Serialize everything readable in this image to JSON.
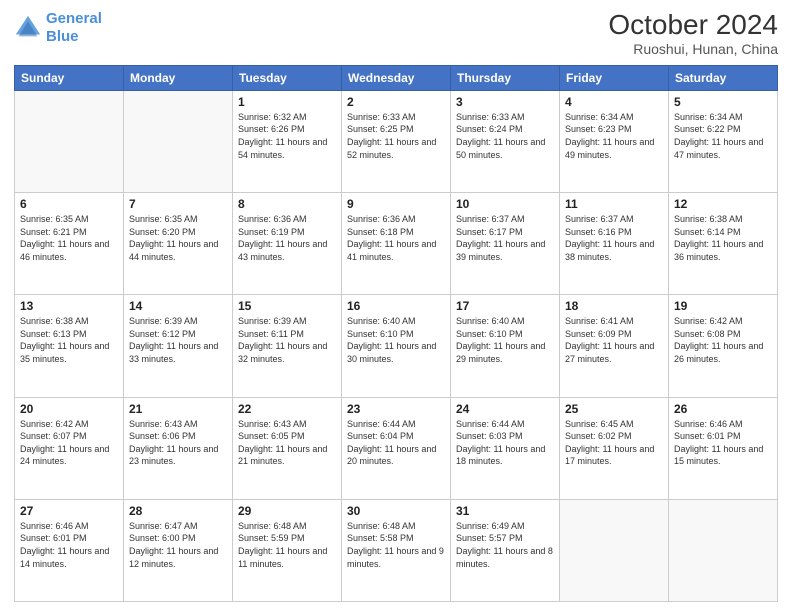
{
  "header": {
    "logo_line1": "General",
    "logo_line2": "Blue",
    "title": "October 2024",
    "subtitle": "Ruoshui, Hunan, China"
  },
  "weekdays": [
    "Sunday",
    "Monday",
    "Tuesday",
    "Wednesday",
    "Thursday",
    "Friday",
    "Saturday"
  ],
  "weeks": [
    [
      {
        "day": "",
        "info": ""
      },
      {
        "day": "",
        "info": ""
      },
      {
        "day": "1",
        "info": "Sunrise: 6:32 AM\nSunset: 6:26 PM\nDaylight: 11 hours and 54 minutes."
      },
      {
        "day": "2",
        "info": "Sunrise: 6:33 AM\nSunset: 6:25 PM\nDaylight: 11 hours and 52 minutes."
      },
      {
        "day": "3",
        "info": "Sunrise: 6:33 AM\nSunset: 6:24 PM\nDaylight: 11 hours and 50 minutes."
      },
      {
        "day": "4",
        "info": "Sunrise: 6:34 AM\nSunset: 6:23 PM\nDaylight: 11 hours and 49 minutes."
      },
      {
        "day": "5",
        "info": "Sunrise: 6:34 AM\nSunset: 6:22 PM\nDaylight: 11 hours and 47 minutes."
      }
    ],
    [
      {
        "day": "6",
        "info": "Sunrise: 6:35 AM\nSunset: 6:21 PM\nDaylight: 11 hours and 46 minutes."
      },
      {
        "day": "7",
        "info": "Sunrise: 6:35 AM\nSunset: 6:20 PM\nDaylight: 11 hours and 44 minutes."
      },
      {
        "day": "8",
        "info": "Sunrise: 6:36 AM\nSunset: 6:19 PM\nDaylight: 11 hours and 43 minutes."
      },
      {
        "day": "9",
        "info": "Sunrise: 6:36 AM\nSunset: 6:18 PM\nDaylight: 11 hours and 41 minutes."
      },
      {
        "day": "10",
        "info": "Sunrise: 6:37 AM\nSunset: 6:17 PM\nDaylight: 11 hours and 39 minutes."
      },
      {
        "day": "11",
        "info": "Sunrise: 6:37 AM\nSunset: 6:16 PM\nDaylight: 11 hours and 38 minutes."
      },
      {
        "day": "12",
        "info": "Sunrise: 6:38 AM\nSunset: 6:14 PM\nDaylight: 11 hours and 36 minutes."
      }
    ],
    [
      {
        "day": "13",
        "info": "Sunrise: 6:38 AM\nSunset: 6:13 PM\nDaylight: 11 hours and 35 minutes."
      },
      {
        "day": "14",
        "info": "Sunrise: 6:39 AM\nSunset: 6:12 PM\nDaylight: 11 hours and 33 minutes."
      },
      {
        "day": "15",
        "info": "Sunrise: 6:39 AM\nSunset: 6:11 PM\nDaylight: 11 hours and 32 minutes."
      },
      {
        "day": "16",
        "info": "Sunrise: 6:40 AM\nSunset: 6:10 PM\nDaylight: 11 hours and 30 minutes."
      },
      {
        "day": "17",
        "info": "Sunrise: 6:40 AM\nSunset: 6:10 PM\nDaylight: 11 hours and 29 minutes."
      },
      {
        "day": "18",
        "info": "Sunrise: 6:41 AM\nSunset: 6:09 PM\nDaylight: 11 hours and 27 minutes."
      },
      {
        "day": "19",
        "info": "Sunrise: 6:42 AM\nSunset: 6:08 PM\nDaylight: 11 hours and 26 minutes."
      }
    ],
    [
      {
        "day": "20",
        "info": "Sunrise: 6:42 AM\nSunset: 6:07 PM\nDaylight: 11 hours and 24 minutes."
      },
      {
        "day": "21",
        "info": "Sunrise: 6:43 AM\nSunset: 6:06 PM\nDaylight: 11 hours and 23 minutes."
      },
      {
        "day": "22",
        "info": "Sunrise: 6:43 AM\nSunset: 6:05 PM\nDaylight: 11 hours and 21 minutes."
      },
      {
        "day": "23",
        "info": "Sunrise: 6:44 AM\nSunset: 6:04 PM\nDaylight: 11 hours and 20 minutes."
      },
      {
        "day": "24",
        "info": "Sunrise: 6:44 AM\nSunset: 6:03 PM\nDaylight: 11 hours and 18 minutes."
      },
      {
        "day": "25",
        "info": "Sunrise: 6:45 AM\nSunset: 6:02 PM\nDaylight: 11 hours and 17 minutes."
      },
      {
        "day": "26",
        "info": "Sunrise: 6:46 AM\nSunset: 6:01 PM\nDaylight: 11 hours and 15 minutes."
      }
    ],
    [
      {
        "day": "27",
        "info": "Sunrise: 6:46 AM\nSunset: 6:01 PM\nDaylight: 11 hours and 14 minutes."
      },
      {
        "day": "28",
        "info": "Sunrise: 6:47 AM\nSunset: 6:00 PM\nDaylight: 11 hours and 12 minutes."
      },
      {
        "day": "29",
        "info": "Sunrise: 6:48 AM\nSunset: 5:59 PM\nDaylight: 11 hours and 11 minutes."
      },
      {
        "day": "30",
        "info": "Sunrise: 6:48 AM\nSunset: 5:58 PM\nDaylight: 11 hours and 9 minutes."
      },
      {
        "day": "31",
        "info": "Sunrise: 6:49 AM\nSunset: 5:57 PM\nDaylight: 11 hours and 8 minutes."
      },
      {
        "day": "",
        "info": ""
      },
      {
        "day": "",
        "info": ""
      }
    ]
  ]
}
